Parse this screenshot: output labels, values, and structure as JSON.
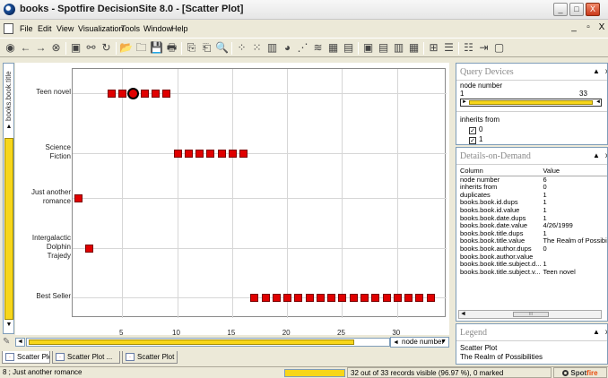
{
  "window": {
    "title": "books - Spotfire DecisionSite 8.0 - [Scatter Plot]",
    "min_glyph": "_",
    "max_glyph": "□",
    "close_glyph": "X"
  },
  "menu": {
    "items": [
      "File",
      "Edit",
      "View",
      "Visualization",
      "Tools",
      "Window",
      "Help"
    ],
    "mdi_min": "_",
    "mdi_restore": "▫",
    "mdi_close": "X"
  },
  "toolbar": {
    "icons": [
      "spotfire-icon",
      "back-icon",
      "forward-icon",
      "stop-icon",
      "document-icon",
      "link-icon",
      "refresh-icon",
      "open-folder-icon",
      "folder-icon",
      "save-icon",
      "print-icon",
      "copy-icon",
      "paste-icon",
      "find-icon",
      "scatter-plot-icon",
      "3d-scatter-icon",
      "bar-chart-icon",
      "pie-chart-icon",
      "line-chart-icon",
      "profile-chart-icon",
      "heat-map-icon",
      "table-icon",
      "layout-1-icon",
      "layout-2-icon",
      "layout-3-icon",
      "layout-4-icon",
      "filter-icon",
      "list-icon",
      "details-icon",
      "export-icon",
      "window-icon"
    ],
    "glyphs": [
      "◉",
      "←",
      "→",
      "⊗",
      "▣",
      "⚯",
      "↻",
      "📂",
      "🗀",
      "💾",
      "🖶",
      "⎘",
      "⎗",
      "🔍",
      "⁘",
      "⁙",
      "▥",
      "◕",
      "⋰",
      "≋",
      "▦",
      "▤",
      "▣",
      "▤",
      "▥",
      "▦",
      "⊞",
      "☰",
      "☷",
      "⇥",
      "▢"
    ]
  },
  "yaxis": {
    "column": "books.book.title",
    "up_arrow": "▲",
    "down_arrow": "▼"
  },
  "chart_data": {
    "type": "scatter",
    "categories": [
      "Teen novel",
      "Science Fiction",
      "Just another romance",
      "Intergalactic Dolphin Trajedy",
      "Best Seller"
    ],
    "category_display": [
      "Teen novel",
      "Science\nFiction",
      "Just another\nromance",
      "Intergalactic\nDolphin\nTrajedy",
      "Best Seller"
    ],
    "xlim": [
      0.5,
      34.5
    ],
    "xticks": [
      5,
      10,
      15,
      20,
      25,
      30
    ],
    "xlabel": "node number",
    "grid": true,
    "marker_color": "#e00000",
    "points": [
      {
        "x": 4,
        "y": "Teen novel"
      },
      {
        "x": 5,
        "y": "Teen novel"
      },
      {
        "x": 6,
        "y": "Teen novel",
        "selected": true
      },
      {
        "x": 7,
        "y": "Teen novel"
      },
      {
        "x": 8,
        "y": "Teen novel"
      },
      {
        "x": 9,
        "y": "Teen novel"
      },
      {
        "x": 10,
        "y": "Science Fiction"
      },
      {
        "x": 11,
        "y": "Science Fiction"
      },
      {
        "x": 12,
        "y": "Science Fiction"
      },
      {
        "x": 13,
        "y": "Science Fiction"
      },
      {
        "x": 14,
        "y": "Science Fiction"
      },
      {
        "x": 15,
        "y": "Science Fiction"
      },
      {
        "x": 16,
        "y": "Science Fiction"
      },
      {
        "x": 1,
        "y": "Just another romance"
      },
      {
        "x": 2,
        "y": "Intergalactic Dolphin Trajedy"
      },
      {
        "x": 17,
        "y": "Best Seller"
      },
      {
        "x": 18,
        "y": "Best Seller"
      },
      {
        "x": 19,
        "y": "Best Seller"
      },
      {
        "x": 20,
        "y": "Best Seller"
      },
      {
        "x": 21,
        "y": "Best Seller"
      },
      {
        "x": 22,
        "y": "Best Seller"
      },
      {
        "x": 23,
        "y": "Best Seller"
      },
      {
        "x": 24,
        "y": "Best Seller"
      },
      {
        "x": 25,
        "y": "Best Seller"
      },
      {
        "x": 26,
        "y": "Best Seller"
      },
      {
        "x": 27,
        "y": "Best Seller"
      },
      {
        "x": 28,
        "y": "Best Seller"
      },
      {
        "x": 29,
        "y": "Best Seller"
      },
      {
        "x": 30,
        "y": "Best Seller"
      },
      {
        "x": 31,
        "y": "Best Seller"
      },
      {
        "x": 32,
        "y": "Best Seller"
      },
      {
        "x": 33,
        "y": "Best Seller"
      }
    ]
  },
  "xaxis_select": {
    "value": "node number",
    "left_arrow": "◄",
    "dropdown_arrow": "▼",
    "slider_fill_fraction": 0.9
  },
  "tabs": [
    "Scatter Plot",
    "Scatter Plot ...",
    "Scatter Plot ..."
  ],
  "status": {
    "left": "8 ; Just another romance",
    "records": "32 out of 33 records visible (96.97 %), 0 marked",
    "brand_a": "Spot",
    "brand_b": "fire"
  },
  "query_devices": {
    "title": "Query Devices",
    "node_label": "node number",
    "range_min": "1",
    "range_max": "33",
    "inherits_label": "inherits from",
    "checks": [
      {
        "label": "0",
        "checked": true
      },
      {
        "label": "1",
        "checked": true
      }
    ],
    "panel_arrow": "▲",
    "panel_close": "x",
    "right_arrow": "►",
    "left_arrow": "◄",
    "check_mark": "✓"
  },
  "details": {
    "title": "Details-on-Demand",
    "col_header": "Column",
    "val_header": "Value",
    "rows": [
      [
        "node number",
        "6"
      ],
      [
        "inherits from",
        "0"
      ],
      [
        "duplicates",
        "1"
      ],
      [
        "books.book.id.dups",
        "1"
      ],
      [
        "books.book.id.value",
        "1"
      ],
      [
        "books.book.date.dups",
        "1"
      ],
      [
        "books.book.date.value",
        "4/26/1999"
      ],
      [
        "books.book.title.dups",
        "1"
      ],
      [
        "books.book.title.value",
        "The Realm of Possibilities"
      ],
      [
        "books.book.author.dups",
        "0"
      ],
      [
        "books.book.author.value",
        ""
      ],
      [
        "books.book.title.subject.d...",
        "1"
      ],
      [
        "books.book.title.subject.v...",
        "Teen novel"
      ]
    ],
    "scroll_left": "◄",
    "scroll_thumb": "III"
  },
  "legend": {
    "title": "Legend",
    "line1": "Scatter Plot",
    "line2": "The Realm of Possibilities"
  }
}
